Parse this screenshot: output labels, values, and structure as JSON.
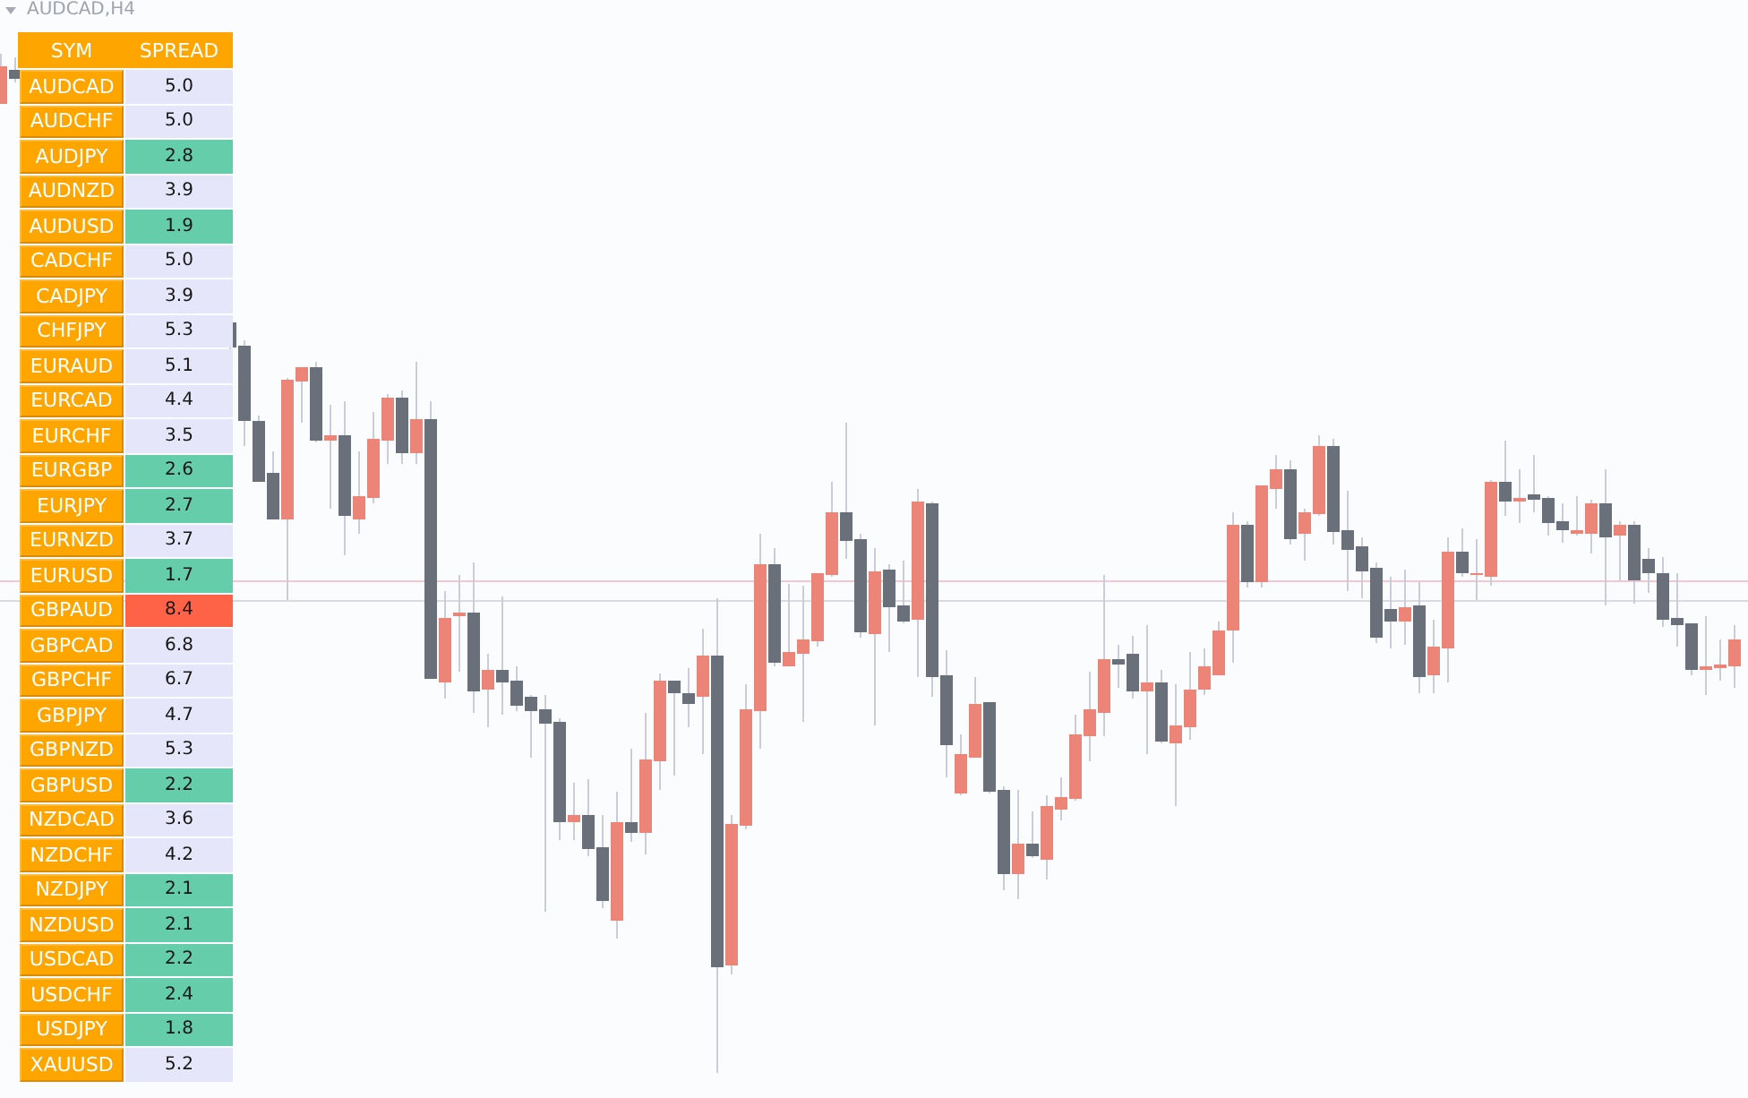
{
  "chart": {
    "title": "AUDCAD,H4"
  },
  "spread_table": {
    "columns": [
      "SYM",
      "SPREAD"
    ],
    "rows": [
      {
        "symbol": "AUDCAD",
        "spread": "5.0",
        "color": "#e6e6fa"
      },
      {
        "symbol": "AUDCHF",
        "spread": "5.0",
        "color": "#e6e6fa"
      },
      {
        "symbol": "AUDJPY",
        "spread": "2.8",
        "color": "#66cdaa"
      },
      {
        "symbol": "AUDNZD",
        "spread": "3.9",
        "color": "#e6e6fa"
      },
      {
        "symbol": "AUDUSD",
        "spread": "1.9",
        "color": "#66cdaa"
      },
      {
        "symbol": "CADCHF",
        "spread": "5.0",
        "color": "#e6e6fa"
      },
      {
        "symbol": "CADJPY",
        "spread": "3.9",
        "color": "#e6e6fa"
      },
      {
        "symbol": "CHFJPY",
        "spread": "5.3",
        "color": "#e6e6fa"
      },
      {
        "symbol": "EURAUD",
        "spread": "5.1",
        "color": "#e6e6fa"
      },
      {
        "symbol": "EURCAD",
        "spread": "4.4",
        "color": "#e6e6fa"
      },
      {
        "symbol": "EURCHF",
        "spread": "3.5",
        "color": "#e6e6fa"
      },
      {
        "symbol": "EURGBP",
        "spread": "2.6",
        "color": "#66cdaa"
      },
      {
        "symbol": "EURJPY",
        "spread": "2.7",
        "color": "#66cdaa"
      },
      {
        "symbol": "EURNZD",
        "spread": "3.7",
        "color": "#e6e6fa"
      },
      {
        "symbol": "EURUSD",
        "spread": "1.7",
        "color": "#66cdaa"
      },
      {
        "symbol": "GBPAUD",
        "spread": "8.4",
        "color": "#ff6347"
      },
      {
        "symbol": "GBPCAD",
        "spread": "6.8",
        "color": "#e6e6fa"
      },
      {
        "symbol": "GBPCHF",
        "spread": "6.7",
        "color": "#e6e6fa"
      },
      {
        "symbol": "GBPJPY",
        "spread": "4.7",
        "color": "#e6e6fa"
      },
      {
        "symbol": "GBPNZD",
        "spread": "5.3",
        "color": "#e6e6fa"
      },
      {
        "symbol": "GBPUSD",
        "spread": "2.2",
        "color": "#66cdaa"
      },
      {
        "symbol": "NZDCAD",
        "spread": "3.6",
        "color": "#e6e6fa"
      },
      {
        "symbol": "NZDCHF",
        "spread": "4.2",
        "color": "#e6e6fa"
      },
      {
        "symbol": "NZDJPY",
        "spread": "2.1",
        "color": "#66cdaa"
      },
      {
        "symbol": "NZDUSD",
        "spread": "2.1",
        "color": "#66cdaa"
      },
      {
        "symbol": "USDCAD",
        "spread": "2.2",
        "color": "#66cdaa"
      },
      {
        "symbol": "USDCHF",
        "spread": "2.4",
        "color": "#66cdaa"
      },
      {
        "symbol": "USDJPY",
        "spread": "1.8",
        "color": "#66cdaa"
      },
      {
        "symbol": "XAUUSD",
        "spread": "5.2",
        "color": "#e6e6fa"
      }
    ]
  }
}
